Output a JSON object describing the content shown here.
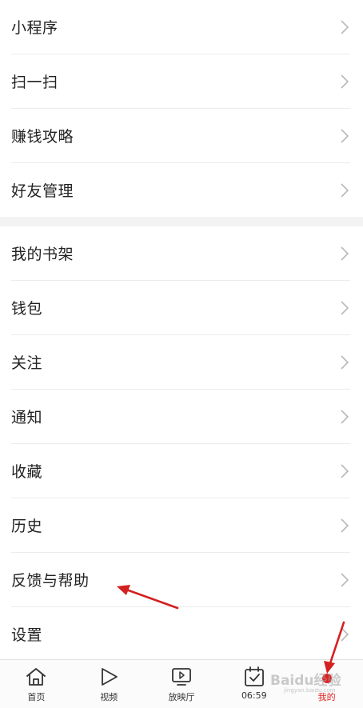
{
  "menu_group_1": [
    {
      "label": "小程序"
    },
    {
      "label": "扫一扫"
    },
    {
      "label": "赚钱攻略"
    },
    {
      "label": "好友管理"
    }
  ],
  "menu_group_2": [
    {
      "label": "我的书架"
    },
    {
      "label": "钱包"
    },
    {
      "label": "关注"
    },
    {
      "label": "通知"
    },
    {
      "label": "收藏"
    },
    {
      "label": "历史"
    },
    {
      "label": "反馈与帮助"
    },
    {
      "label": "设置"
    }
  ],
  "tabbar": {
    "tabs": [
      {
        "label": "首页",
        "icon": "home-icon"
      },
      {
        "label": "视频",
        "icon": "play-icon"
      },
      {
        "label": "放映厅",
        "icon": "screen-play-icon"
      },
      {
        "label": "06:59",
        "icon": "calendar-check-icon"
      },
      {
        "label": "我的",
        "icon": "profile-icon",
        "active": true
      }
    ]
  },
  "watermark": {
    "text": "Baidu经验",
    "sub": "jingyan.baidu.com"
  },
  "colors": {
    "accent": "#e02020",
    "annotation_arrow": "#d42020",
    "separator_band": "#f3f3f3"
  }
}
